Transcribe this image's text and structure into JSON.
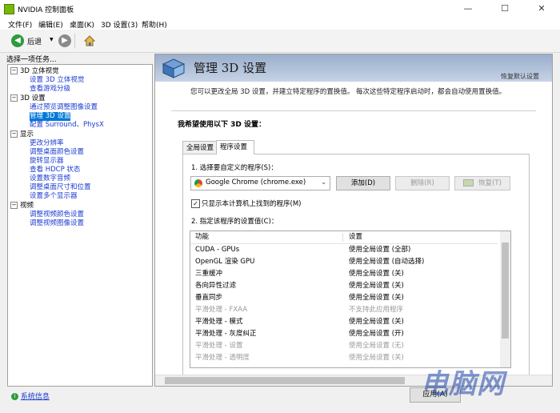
{
  "window": {
    "title": "NVIDIA 控制面板"
  },
  "window_controls": {
    "minimize": "—",
    "maximize": "☐",
    "close": "✕"
  },
  "menu": [
    "文件(F)",
    "编辑(E)",
    "桌面(K)",
    "3D 设置(3)",
    "帮助(H)"
  ],
  "toolbar": {
    "back_label": "后退",
    "dropdown_glyph": "▼"
  },
  "left": {
    "header": "选择一项任务...",
    "tree": [
      {
        "label": "3D 立体视觉",
        "level": 0,
        "expanded": true
      },
      {
        "label": "设置 3D 立体视觉",
        "level": 1,
        "link": true
      },
      {
        "label": "查看游戏分级",
        "level": 1,
        "link": true
      },
      {
        "label": "3D 设置",
        "level": 0,
        "expanded": true
      },
      {
        "label": "通过预览调整图像设置",
        "level": 1,
        "link": true
      },
      {
        "label": "管理 3D 设置",
        "level": 1,
        "link": true,
        "selected": true
      },
      {
        "label": "配置 Surround、PhysX",
        "level": 1,
        "link": true
      },
      {
        "label": "显示",
        "level": 0,
        "expanded": true
      },
      {
        "label": "更改分辨率",
        "level": 1,
        "link": true
      },
      {
        "label": "调整桌面颜色设置",
        "level": 1,
        "link": true
      },
      {
        "label": "旋转显示器",
        "level": 1,
        "link": true
      },
      {
        "label": "查看 HDCP 状态",
        "level": 1,
        "link": true
      },
      {
        "label": "设置数字音频",
        "level": 1,
        "link": true
      },
      {
        "label": "调整桌面尺寸和位置",
        "level": 1,
        "link": true
      },
      {
        "label": "设置多个显示器",
        "level": 1,
        "link": true
      },
      {
        "label": "视频",
        "level": 0,
        "expanded": true
      },
      {
        "label": "调整视频颜色设置",
        "level": 1,
        "link": true
      },
      {
        "label": "调整视频图像设置",
        "level": 1,
        "link": true
      }
    ],
    "system_info": "系统信息"
  },
  "main": {
    "title": "管理 3D 设置",
    "restore_default": "恢复默认设置",
    "description": "您可以更改全局 3D 设置，并建立特定程序的置换值。 每次这些特定程序启动时，都会自动使用置换值。",
    "prompt": "我希望使用以下 3D 设置：",
    "tabs": [
      {
        "label": "全局设置",
        "active": false
      },
      {
        "label": "程序设置",
        "active": true
      }
    ],
    "step1": "1. 选择要自定义的程序(S)：",
    "program_selected": "Google Chrome (chrome.exe)",
    "add_button": "添加(D)",
    "remove_button": "删除(R)",
    "restore_button": "恢复(T)",
    "checkbox_label": "只显示本计算机上找到的程序(M)",
    "checkbox_checked": true,
    "step2": "2. 指定该程序的设置值(C)：",
    "columns": [
      "功能",
      "设置"
    ],
    "rows": [
      {
        "feature": "CUDA - GPUs",
        "setting": "使用全局设置 (全部)",
        "dim": false
      },
      {
        "feature": "OpenGL 渲染 GPU",
        "setting": "使用全局设置 (自动选择)",
        "dim": false
      },
      {
        "feature": "三重缓冲",
        "setting": "使用全局设置 (关)",
        "dim": false
      },
      {
        "feature": "各向异性过滤",
        "setting": "使用全局设置 (关)",
        "dim": false
      },
      {
        "feature": "垂直同步",
        "setting": "使用全局设置 (关)",
        "dim": false
      },
      {
        "feature": "平滑处理 - FXAA",
        "setting": "不支持此应用程序",
        "dim": true
      },
      {
        "feature": "平滑处理 - 模式",
        "setting": "使用全局设置 (关)",
        "dim": false
      },
      {
        "feature": "平滑处理 - 灰度纠正",
        "setting": "使用全局设置 (开)",
        "dim": false
      },
      {
        "feature": "平滑处理 - 设置",
        "setting": "使用全局设置 (无)",
        "dim": true
      },
      {
        "feature": "平滑处理 - 透明度",
        "setting": "使用全局设置 (关)",
        "dim": true
      }
    ],
    "apply_button": "应用(A)"
  },
  "watermark": "电脑网"
}
